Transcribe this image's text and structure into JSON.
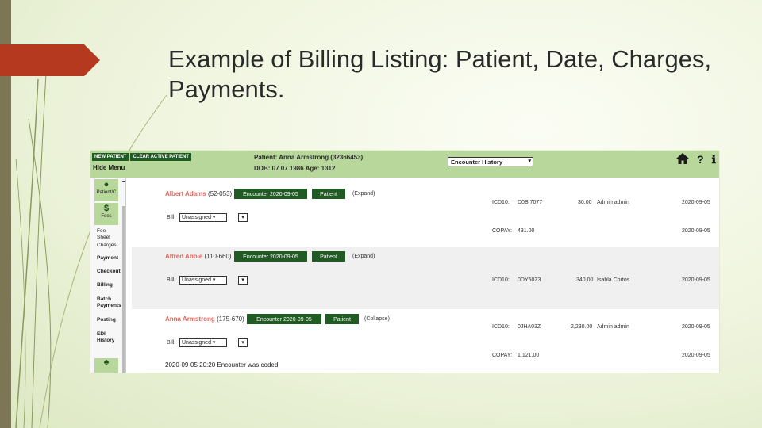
{
  "slide": {
    "title": "Example of Billing Listing: Patient, Date, Charges, Payments."
  },
  "colors": {
    "accent": "#b8d79a",
    "button": "#1f5b22",
    "patient_name": "#e0695e",
    "arrow": "#b5391f"
  },
  "app": {
    "toolbar": {
      "new_patient": "NEW PATIENT",
      "clear_active_patient": "CLEAR ACTIVE PATIENT",
      "hide_menu": "Hide Menu",
      "patient_line": "Patient: Anna Armstrong (32366453)",
      "dob_line": "DOB: 07 07 1986 Age: 1312",
      "encounter_select": "Encounter History",
      "home_icon": "home-icon",
      "help_icon": "question-icon",
      "info_icon": "info-icon"
    },
    "sidebar": {
      "minimize": "–",
      "patient_tile": "Patient/C",
      "fees_tile": "Fees",
      "items": [
        "Fee Sheet",
        "Charges",
        "Payment",
        "Checkout",
        "Billing",
        "Batch Payments",
        "Posting",
        "EDI History"
      ]
    },
    "rows": [
      {
        "name": "Albert Adams",
        "id": "(52-053)",
        "encounter": "Encounter 2020-09-05",
        "patient_btn": "Patient",
        "toggle": "(Expand)",
        "bill_label": "Bill:",
        "bill_value": "Unassigned",
        "icd": "ICD10:",
        "icd_code": "D0B 7077",
        "amount": "30.00",
        "user": "Admin admin",
        "date1": "2020-09-05",
        "copay": "COPAY:",
        "copay_amount": "431.00",
        "date2": "2020-09-05"
      },
      {
        "name": "Alfred Abbie",
        "id": "(110-660)",
        "encounter": "Encounter 2020-09-05",
        "patient_btn": "Patient",
        "toggle": "(Expand)",
        "bill_label": "Bill:",
        "bill_value": "Unassigned",
        "icd": "ICD10:",
        "icd_code": "0DY50Z3",
        "amount": "340.00",
        "user": "Isabla Cortos",
        "date1": "2020-09-05"
      },
      {
        "name": "Anna Armstrong",
        "id": "(175-670)",
        "encounter": "Encounter 2020-09-05",
        "patient_btn": "Patient",
        "toggle": "(Collapse)",
        "bill_label": "Bill:",
        "bill_value": "Unassigned",
        "icd": "ICD10:",
        "icd_code": "0JHA03Z",
        "amount": "2,230.00",
        "user": "Admin admin",
        "date1": "2020-09-05",
        "copay": "COPAY:",
        "copay_amount": "1,121.00",
        "date2": "2020-09-05",
        "log": "2020-09-05 20:20 Encounter was coded"
      }
    ]
  }
}
